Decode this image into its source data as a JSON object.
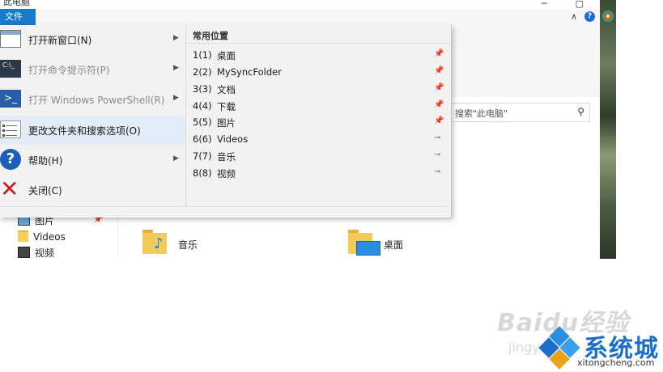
{
  "window": {
    "title_fragment": "此电脑",
    "search_placeholder": "搜索\"此电脑\""
  },
  "file_menu": {
    "tab_label": "文件",
    "items": [
      {
        "label": "打开新窗口(N)",
        "icon": "new-window-icon",
        "has_submenu": true,
        "enabled": true
      },
      {
        "label": "打开命令提示符(P)",
        "icon": "command-prompt-icon",
        "has_submenu": true,
        "enabled": false
      },
      {
        "label": "打开 Windows PowerShell(R)",
        "icon": "powershell-icon",
        "has_submenu": true,
        "enabled": false
      },
      {
        "label": "更改文件夹和搜索选项(O)",
        "icon": "folder-options-icon",
        "has_submenu": false,
        "enabled": true,
        "highlighted": true
      },
      {
        "label": "帮助(H)",
        "icon": "help-icon",
        "has_submenu": true,
        "enabled": true
      },
      {
        "label": "关闭(C)",
        "icon": "close-icon",
        "has_submenu": false,
        "enabled": true
      }
    ],
    "frequent_places": {
      "title": "常用位置",
      "items": [
        {
          "num": "1(1)",
          "name": "桌面",
          "pinned": true
        },
        {
          "num": "2(2)",
          "name": "MySyncFolder",
          "pinned": true
        },
        {
          "num": "3(3)",
          "name": "文档",
          "pinned": true
        },
        {
          "num": "4(4)",
          "name": "下载",
          "pinned": true
        },
        {
          "num": "5(5)",
          "name": "图片",
          "pinned": true
        },
        {
          "num": "6(6)",
          "name": "Videos",
          "pinned": false
        },
        {
          "num": "7(7)",
          "name": "音乐",
          "pinned": false
        },
        {
          "num": "8(8)",
          "name": "视频",
          "pinned": false
        }
      ]
    }
  },
  "nav_pane": {
    "items": [
      {
        "label": "图片"
      },
      {
        "label": "Videos"
      },
      {
        "label": "视频"
      }
    ]
  },
  "content": {
    "folders": [
      {
        "label": "音乐"
      },
      {
        "label": "桌面"
      }
    ]
  },
  "watermark": {
    "baidu": "Baidu经验",
    "jingyan": "jingyan",
    "brand": "系统城",
    "url": "xitongcheng.com"
  },
  "colors": {
    "file_tab": "#1979ca",
    "menu_bg": "#f2f2f2",
    "highlight": "#e3ecf7",
    "brand_blue": "#1a6fc8"
  }
}
